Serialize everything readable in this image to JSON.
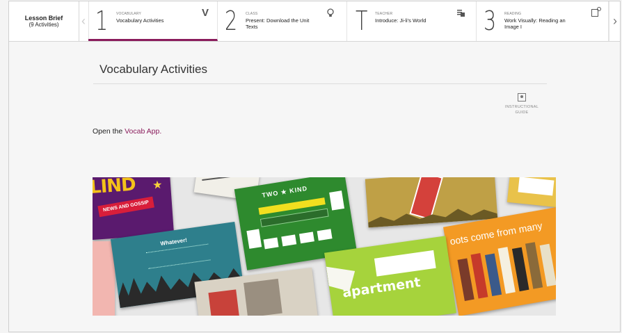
{
  "lesson_brief": {
    "title": "Lesson Brief",
    "subtitle": "(9 Activities)"
  },
  "nav": {
    "prev": "‹",
    "next": "›",
    "steps": [
      {
        "number": "1",
        "category": "VOCABULARY",
        "title": "Vocabulary Activities",
        "icon": "V",
        "active": true
      },
      {
        "number": "2",
        "category": "CLASS",
        "title": "Present: Download the Unit Texts",
        "icon": "lightbulb-icon",
        "active": false
      },
      {
        "number": "T",
        "category": "TEACHER",
        "title": "Introduce: Ji-li's World",
        "icon": "notes-icon",
        "active": false
      },
      {
        "number": "3",
        "category": "READING",
        "title": "Work Visually: Reading an Image I",
        "icon": "edit-icon",
        "active": false
      }
    ]
  },
  "content": {
    "title": "Vocabulary Activities",
    "guide_label": "INSTRUCTIONAL GUIDE",
    "open_prefix": "Open the ",
    "open_link": "Vocab App."
  },
  "collage_text": {
    "news": "NEWS AND GOSSIP",
    "two_kind": "TWO ★ KIND",
    "roots": "oots come from many",
    "apartment": "apartment",
    "whatever": "Whatever!"
  },
  "colors": {
    "accent": "#8a1c5c",
    "border": "#d6d6d6"
  }
}
